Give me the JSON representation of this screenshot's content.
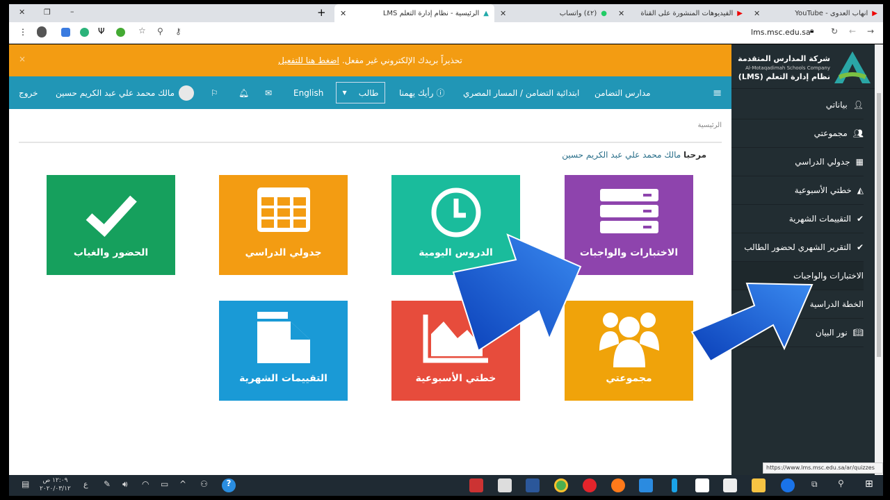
{
  "browser": {
    "tabs": [
      {
        "title": "انهاب العدوى - YouTube"
      },
      {
        "title": "الفيديوهات المنشورة على القناة"
      },
      {
        "title": "(٤٢) واتساب"
      },
      {
        "title": "الرئيسية - نظام إدارة التعلم LMS"
      }
    ],
    "url": "lms.msc.edu.sa"
  },
  "banner": {
    "text": "تحذيراً بريدك الإلكتروني غير مفعل.",
    "link": "اضغط هنا للتفعيل",
    "close": "×"
  },
  "topnav": {
    "school": "مدارس التضامن",
    "branch": "ابتدائية التضامن / المسار المصري",
    "feedback": "رأيك يهمنا",
    "role": "طالب",
    "language": "English",
    "user": "مالك محمد علي عبد الكريم حسين",
    "logout": "خروج"
  },
  "breadcrumb": "الرئيسية",
  "welcome": {
    "prefix": "مرحبا",
    "name": "مالك محمد علي عبد الكريم حسين"
  },
  "tiles": [
    {
      "label": "الاختبارات والواجبات",
      "color": "#8e44ad",
      "icon": "server-icon"
    },
    {
      "label": "الدروس اليومية",
      "color": "#1abc9c",
      "icon": "clock-icon"
    },
    {
      "label": "جدولي الدراسي",
      "color": "#f39c12",
      "icon": "table-icon"
    },
    {
      "label": "الحضور والغياب",
      "color": "#16a05d",
      "icon": "check-icon"
    },
    {
      "label": "مجموعتي",
      "color": "#f0a30a",
      "icon": "users-icon"
    },
    {
      "label": "خطتي الأسبوعية",
      "color": "#e74c3c",
      "icon": "area-chart-icon"
    },
    {
      "label": "التقييمات الشهرية",
      "color": "#1a9ad6",
      "icon": "file-icon"
    }
  ],
  "sidebar": {
    "brand_ar": "شركة المدارس المتقدمة",
    "brand_en": "Al-Motaqadimah Schools Company",
    "brand_sub": "نظام إدارة التعلم (LMS)",
    "items": [
      {
        "label": "بياناتي",
        "icon": "user-icon"
      },
      {
        "label": "مجموعتي",
        "icon": "users-icon"
      },
      {
        "label": "جدولي الدراسي",
        "icon": "table-icon"
      },
      {
        "label": "خطتي الأسبوعية",
        "icon": "area-chart-icon"
      },
      {
        "label": "التقييمات الشهرية",
        "icon": "check-icon"
      },
      {
        "label": "التقرير الشهري لحضور الطالب",
        "icon": "check-icon"
      },
      {
        "label": "الاختبارات والواجبات",
        "icon": ""
      },
      {
        "label": "الخطة الدراسية",
        "icon": ""
      },
      {
        "label": "نور البيان",
        "icon": "book-icon"
      }
    ]
  },
  "status_url": "https://www.lms.msc.edu.sa/ar/quizzes",
  "taskbar": {
    "time": "١٢:٠٩ ص",
    "date": "٢٠٢٠/٠٣/١٢",
    "lang": "ع"
  }
}
